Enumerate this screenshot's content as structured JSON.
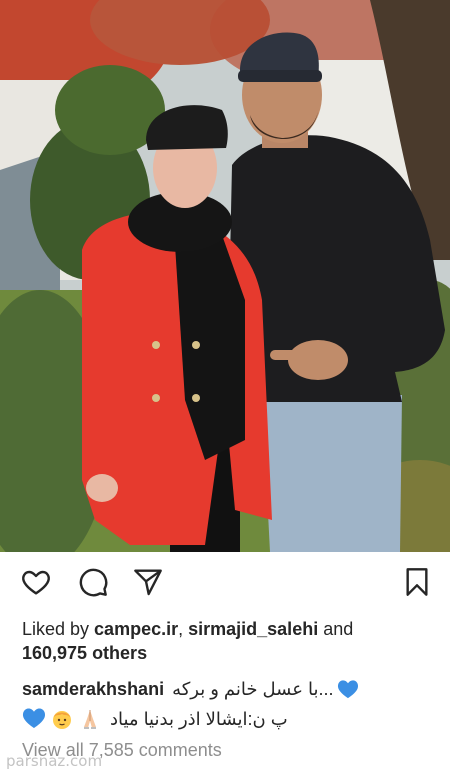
{
  "post": {
    "likes_prefix": "Liked by ",
    "liker_1": "campec.ir",
    "liker_sep": ", ",
    "liker_2": "sirmajid_salehi",
    "likes_and": " and",
    "likes_count": "160,975 others",
    "username": "samderakhshani",
    "caption_line1": "...با عسل خانم و بركه",
    "caption_line2": "پ ن:ایشالا اذر بدنیا میاد",
    "view_comments": "View all 7,585 comments",
    "watermark": "parsnaz.com"
  },
  "icons": {
    "like": "heart-outline-icon",
    "comment": "speech-bubble-icon",
    "share": "paper-plane-icon",
    "save": "bookmark-icon",
    "caption_emoji": "blue-heart-emoji",
    "emoji_praying": "praying-hands-emoji",
    "emoji_baby": "baby-emoji"
  },
  "colors": {
    "text": "#262626",
    "muted": "#8e8e8e",
    "blue_heart": "#3b8fe4",
    "coat": "#e8372c"
  }
}
